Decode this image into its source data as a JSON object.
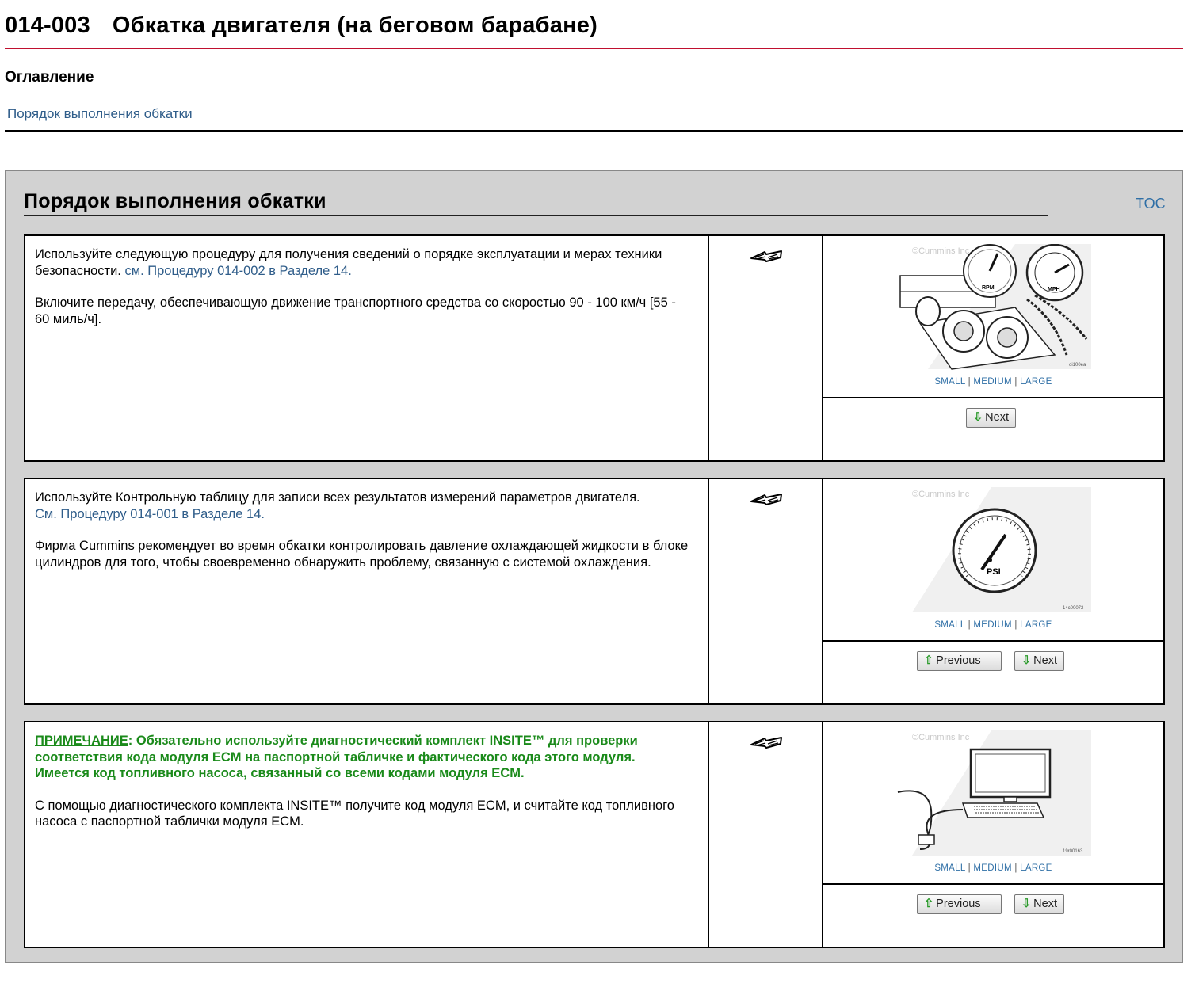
{
  "header": {
    "code": "014-003",
    "title": "Обкатка двигателя (на беговом барабане)"
  },
  "toc": {
    "heading": "Оглавление",
    "links": [
      "Порядок выполнения обкатки"
    ]
  },
  "section": {
    "title": "Порядок выполнения обкатки",
    "toc_link": "TOC"
  },
  "image_size_links": {
    "small": "SMALL",
    "medium": "MEDIUM",
    "large": "LARGE",
    "separator": "|"
  },
  "steps": [
    {
      "p1_text": "Используйте следующую процедуру для получения сведений о порядке эксплуатации и мерах техники безопасности.",
      "p1_link": "см. Процедуру 014-002 в Разделе 14.",
      "p2_text": "Включите передачу, обеспечивающую движение транспортного средства со скоростью 90 - 100 км/ч [55 - 60 миль/ч].",
      "illustration": {
        "watermark": "©Cummins Inc",
        "gauge_labels": [
          "RPM",
          "MPH"
        ],
        "code": "oi100ea"
      },
      "buttons": {
        "next": "Next"
      }
    },
    {
      "p1_text": "Используйте Контрольную таблицу для записи всех результатов измерений параметров двигателя.",
      "p1_link": "См. Процедуру 014-001 в Разделе 14.",
      "p2_text": "Фирма Cummins рекомендует во время обкатки контролировать давление охлаждающей жидкости в блоке цилиндров для того, чтобы своевременно обнаружить проблему, связанную с системой охлаждения.",
      "illustration": {
        "watermark": "©Cummins Inc",
        "gauge_labels": [
          "PSI"
        ],
        "code": "14c00072"
      },
      "buttons": {
        "previous": "Previous",
        "next": "Next"
      }
    },
    {
      "note_label": "ПРИМЕЧАНИЕ",
      "note_text": ": Обязательно используйте диагностический комплект INSITE™ для проверки соответствия кода модуля ECM на паспортной табличке и фактического кода этого модуля. Имеется код топливного насоса, связанный со всеми кодами модуля ECM.",
      "p2_text": "С помощью диагностического комплекта INSITE™ получите код модуля ECM, и считайте код топливного насоса с паспортной таблички модуля ECM.",
      "illustration": {
        "watermark": "©Cummins Inc",
        "code": "19r00163"
      },
      "buttons": {
        "previous": "Previous",
        "next": "Next"
      }
    }
  ],
  "colors": {
    "title_rule": "#c0102f",
    "link": "#2f5d8a",
    "note": "#1a8a1a",
    "panel_bg": "#d2d2d2"
  }
}
